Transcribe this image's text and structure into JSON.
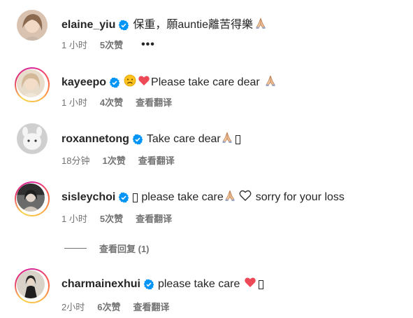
{
  "comments": [
    {
      "username": "elaine_yiu",
      "text": "保重，願auntie離苦得樂",
      "emojis": [
        "praying-hands"
      ],
      "time": "1 小时",
      "likes": "5次赞",
      "action": "•••"
    },
    {
      "username": "kayeepo",
      "text": "Please take care dear",
      "emojis_before": [
        "sad-face",
        "red-heart"
      ],
      "emojis": [
        "praying-hands"
      ],
      "time": "1 小时",
      "likes": "4次赞",
      "action": "查看翻译"
    },
    {
      "username": "roxannetong",
      "text": "Take care dear",
      "emojis": [
        "praying-hands",
        "missing-glyph"
      ],
      "time": "18分钟",
      "likes": "1次赞",
      "action": "查看翻译"
    },
    {
      "username": "sisleychoi",
      "text_1": "please take care",
      "text_2": "sorry for your loss",
      "emojis_before": [
        "missing-glyph"
      ],
      "emojis": [
        "praying-hands",
        "white-heart"
      ],
      "time": "1 小时",
      "likes": "5次赞",
      "action": "查看翻译"
    },
    {
      "username": "charmainexhui",
      "text": "please take care",
      "emojis": [
        "red-heart",
        "missing-glyph"
      ],
      "time": "2小时",
      "likes": "6次赞",
      "action": "查看翻译"
    }
  ],
  "view_replies": "查看回复 (1)",
  "colors": {
    "text": "#262626",
    "secondary": "#737373",
    "verified": "#0095f6",
    "heart": "#ed4956"
  }
}
